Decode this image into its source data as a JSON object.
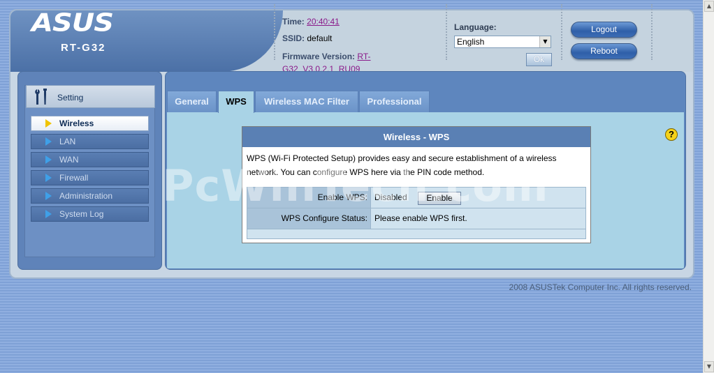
{
  "brand": {
    "logo": "ASUS",
    "model": "RT-G32"
  },
  "header": {
    "time_label": "Time:",
    "time_value": "20:40:41",
    "ssid_label": "SSID:",
    "ssid_value": "default",
    "firmware_label": "Firmware Version:",
    "firmware_value_line1": "RT-",
    "firmware_value_line2": "G32_V3.0.2.1_RU09",
    "language_label": "Language:",
    "language_selected": "English",
    "ok_label": "Ok",
    "logout_label": "Logout",
    "reboot_label": "Reboot"
  },
  "sidebar": {
    "section_label": "Setting",
    "items": [
      {
        "label": "Wireless",
        "active": true
      },
      {
        "label": "LAN",
        "active": false
      },
      {
        "label": "WAN",
        "active": false
      },
      {
        "label": "Firewall",
        "active": false
      },
      {
        "label": "Administration",
        "active": false
      },
      {
        "label": "System Log",
        "active": false
      }
    ]
  },
  "tabs": [
    {
      "label": "General",
      "active": false
    },
    {
      "label": "WPS",
      "active": true
    },
    {
      "label": "Wireless MAC Filter",
      "active": false
    },
    {
      "label": "Professional",
      "active": false
    }
  ],
  "wps": {
    "title": "Wireless - WPS",
    "description": "WPS (Wi-Fi Protected Setup) provides easy and secure establishment of a wireless network. You can configure WPS here via the PIN code method.",
    "enable_label": "Enable WPS:",
    "enable_value": "Disabled",
    "enable_button": "Enable",
    "status_label": "WPS Configure Status:",
    "status_value": "Please enable WPS first."
  },
  "help_icon_symbol": "?",
  "watermark": "PcWinTech.com",
  "footer": {
    "copyright": "2008 ASUSTek Computer Inc. All rights reserved."
  },
  "colors": {
    "frame_bg": "#c8d6e4",
    "panel_blue": "#5e86be",
    "content_bg": "#a9d3e6",
    "active_arrow": "#f0c400",
    "link": "#8a1a8a"
  },
  "icons": {
    "setting": "wrench-screwdriver-icon",
    "help": "question-icon",
    "menu_arrow": "triangle-right-icon"
  }
}
